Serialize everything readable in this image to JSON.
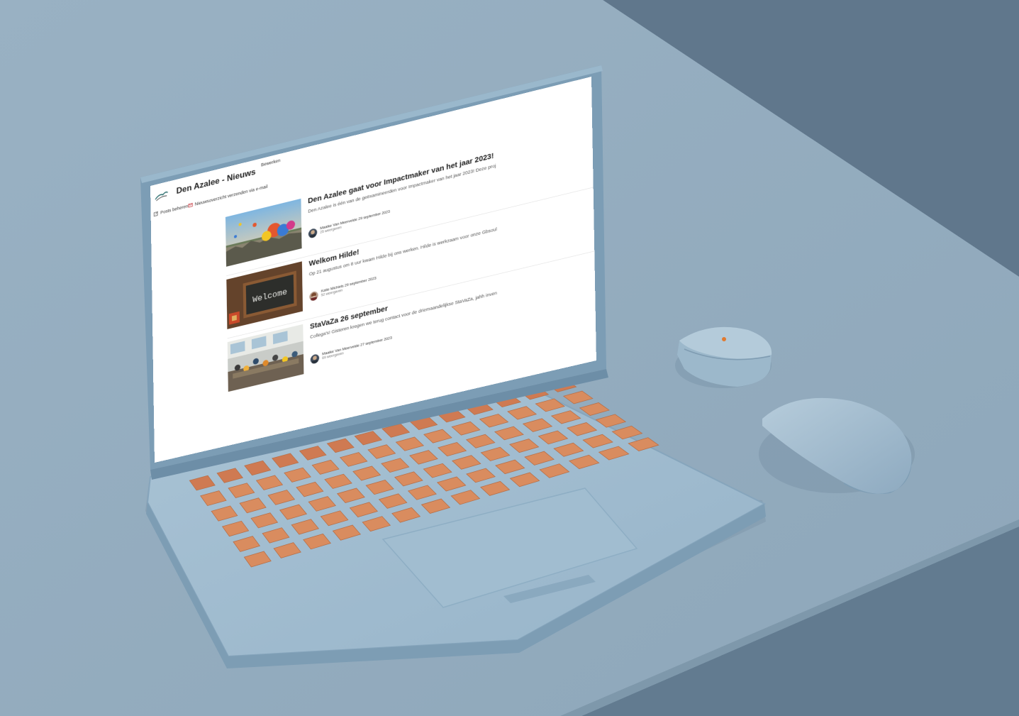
{
  "site": {
    "title": "Den Azalee - Nieuws",
    "nav_link": "Bewerken"
  },
  "command_bar": {
    "post_label": "Posts beheren",
    "email_label": "Nieuwsoverzicht verzenden via e-mail"
  },
  "posts": [
    {
      "title": "Den Azalee gaat voor Impactmaker van het jaar 2023!",
      "excerpt": "Den Azalee is één van de geëxamineerden voor Impactmaker van het jaar 2023! Deze proj",
      "author_line": "Maaike Van Meervelde 29 september 2023",
      "views": "25 weergaven",
      "thumb_text": ""
    },
    {
      "title": "Welkom Hilde!",
      "excerpt": "Op 21 augustus om 8 uur kwam Hilde bij ons werken. Hilde is werkzaam voor onze Gbsoul",
      "author_line": "Katie Michiels 29 september 2023",
      "views": "52 weergaven",
      "thumb_text": "Welcome"
    },
    {
      "title": "StaVaZa 26 september",
      "excerpt": "Collega's! Gisteren kregen we terug contact voor de driemaandelijkse StaVaZa, jahh inven",
      "author_line": "Maaike Van Meervelde 27 september 2023",
      "views": "69 weergaven",
      "thumb_text": ""
    }
  ],
  "colors": {
    "background": "#9cb2c3",
    "laptop": "#8fb1c9",
    "keys": "#d98c5f",
    "accent_brand": "#c0262d"
  }
}
